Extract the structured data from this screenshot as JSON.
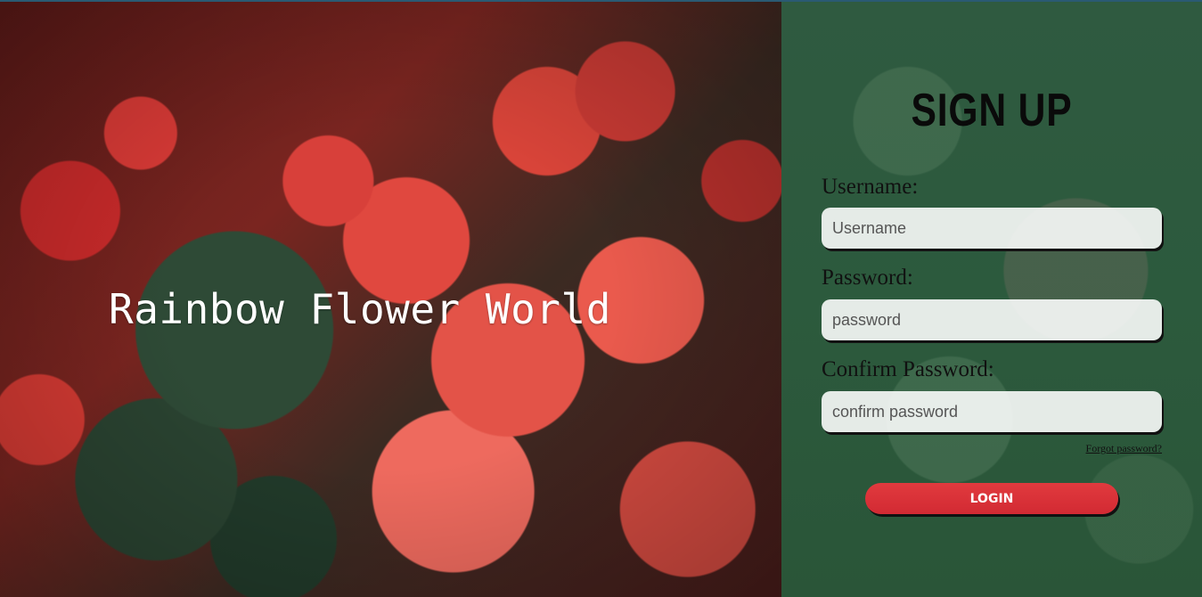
{
  "hero": {
    "title": "Rainbow Flower World"
  },
  "form": {
    "title": "SIGN UP",
    "username": {
      "label": "Username:",
      "placeholder": "Username"
    },
    "password": {
      "label": "Password:",
      "placeholder": "password"
    },
    "confirm_password": {
      "label": "Confirm Password:",
      "placeholder": "confirm password"
    },
    "forgot_link": "Forgot password?",
    "submit_label": "LOGIN"
  },
  "colors": {
    "panel_green": "#2c5a3d",
    "button_red": "#d92f36",
    "hero_text": "#ffffff"
  }
}
